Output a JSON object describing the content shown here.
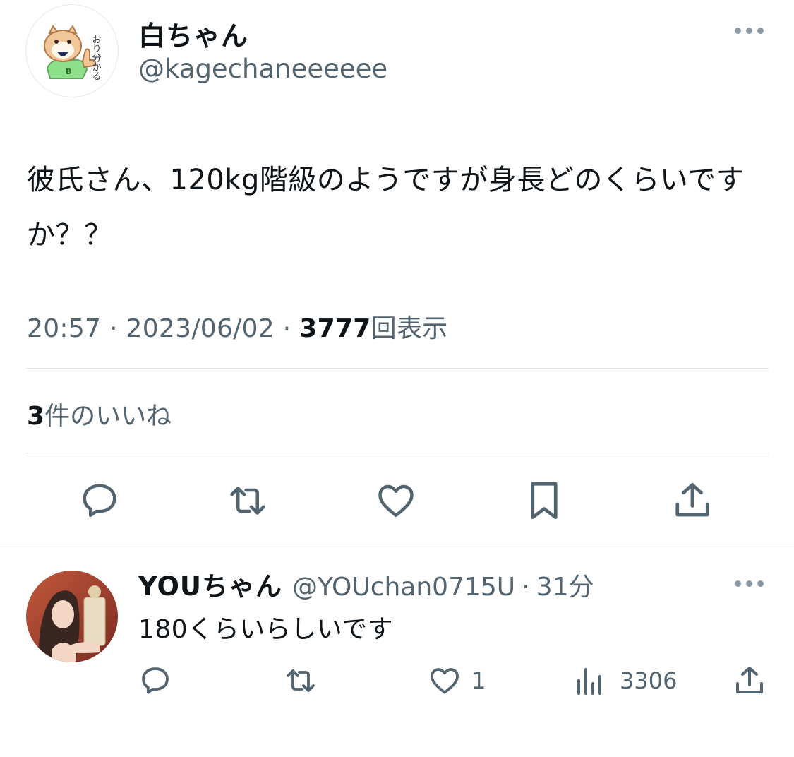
{
  "tweet": {
    "author_name": "白ちゃん",
    "author_handle": "@kagechaneeeeee",
    "avatar_caption": "おり分かる",
    "avatar_shirt_letter": "B",
    "text": "彼氏さん、120kg階級のようですが身長どのくらいですか？？",
    "time": "20:57",
    "separator": "·",
    "date": "2023/06/02",
    "views_count": "3777",
    "views_label": "回表示",
    "likes_count": "3",
    "likes_label": "件のいいね"
  },
  "actions": {
    "reply_icon": "reply-icon",
    "retweet_icon": "retweet-icon",
    "like_icon": "heart-icon",
    "bookmark_icon": "bookmark-icon",
    "share_icon": "share-icon"
  },
  "reply": {
    "author_name": "YOUちゃん",
    "author_handle": "@YOUchan0715U",
    "separator": "·",
    "time_ago": "31分",
    "text": "180くらいらしいです",
    "likes": "1",
    "views": "3306"
  },
  "colors": {
    "text": "#0f1419",
    "secondary": "#536471",
    "divider": "#dfe3e6"
  }
}
